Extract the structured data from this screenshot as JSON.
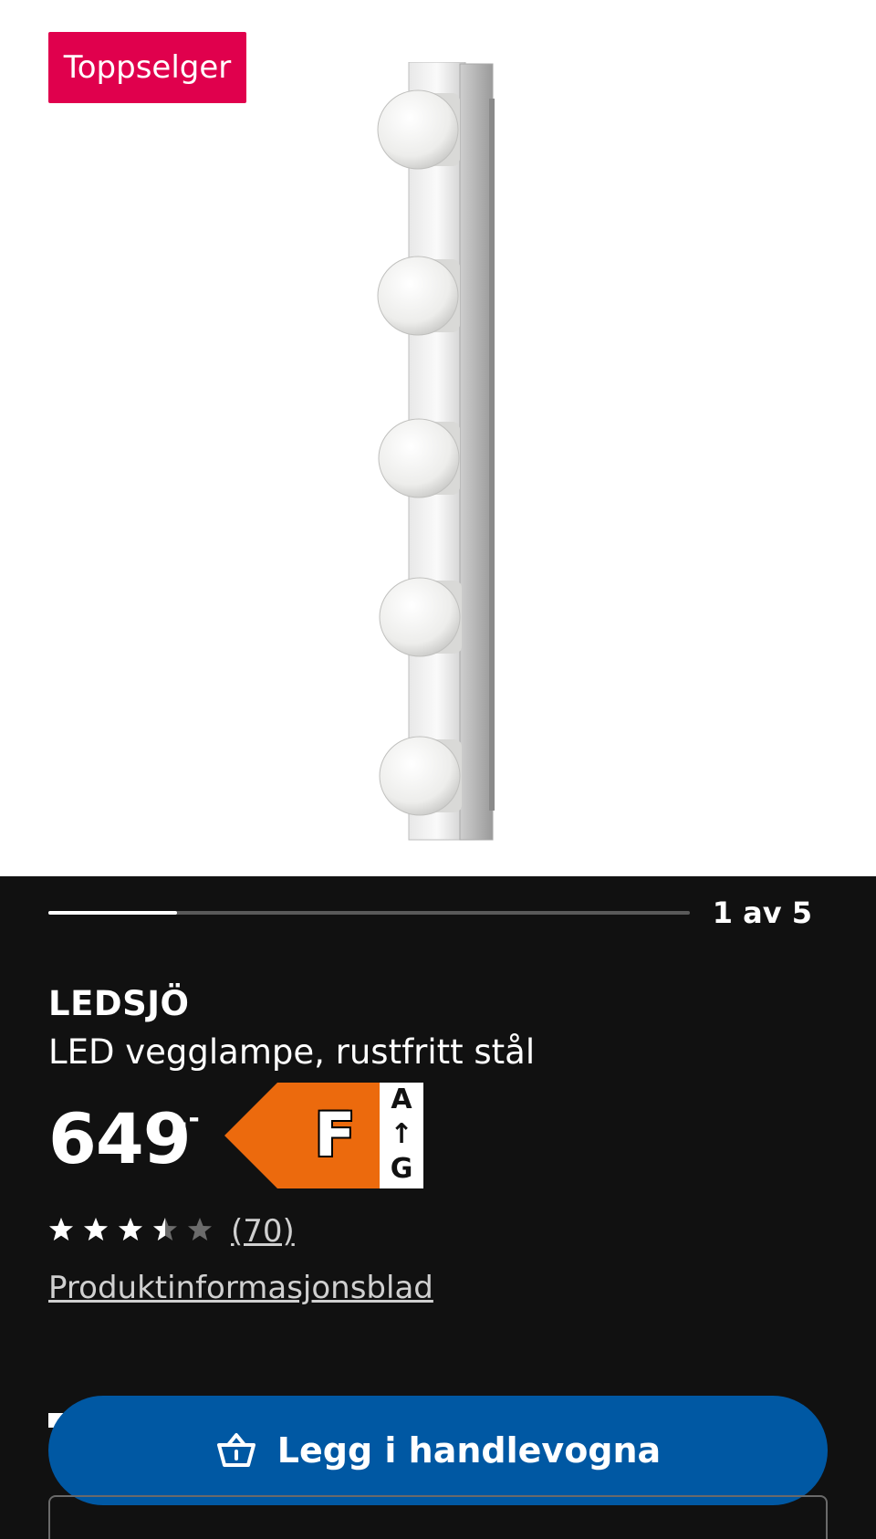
{
  "badge": {
    "label": "Toppselger",
    "color": "#e0004d"
  },
  "gallery": {
    "counter": "1 av 5",
    "current": 1,
    "total": 5,
    "progress_fraction": 0.2
  },
  "product": {
    "name": "LEDSJÖ",
    "description": "LED vegglampe, rustfritt stål",
    "price_integer": "649",
    "price_decimal": ",-"
  },
  "energy_label": {
    "class": "F",
    "scale_top": "A",
    "scale_arrow": "↑",
    "scale_bottom": "G",
    "color": "#ec6a0d"
  },
  "rating": {
    "value": 3.5,
    "max": 5,
    "count_label": "(70)"
  },
  "links": {
    "product_info_sheet": "Produktinformasjonsblad"
  },
  "cart_button": {
    "label": "Legg i handlevogna",
    "icon": "shopping-basket-icon",
    "color": "#0058a3"
  }
}
